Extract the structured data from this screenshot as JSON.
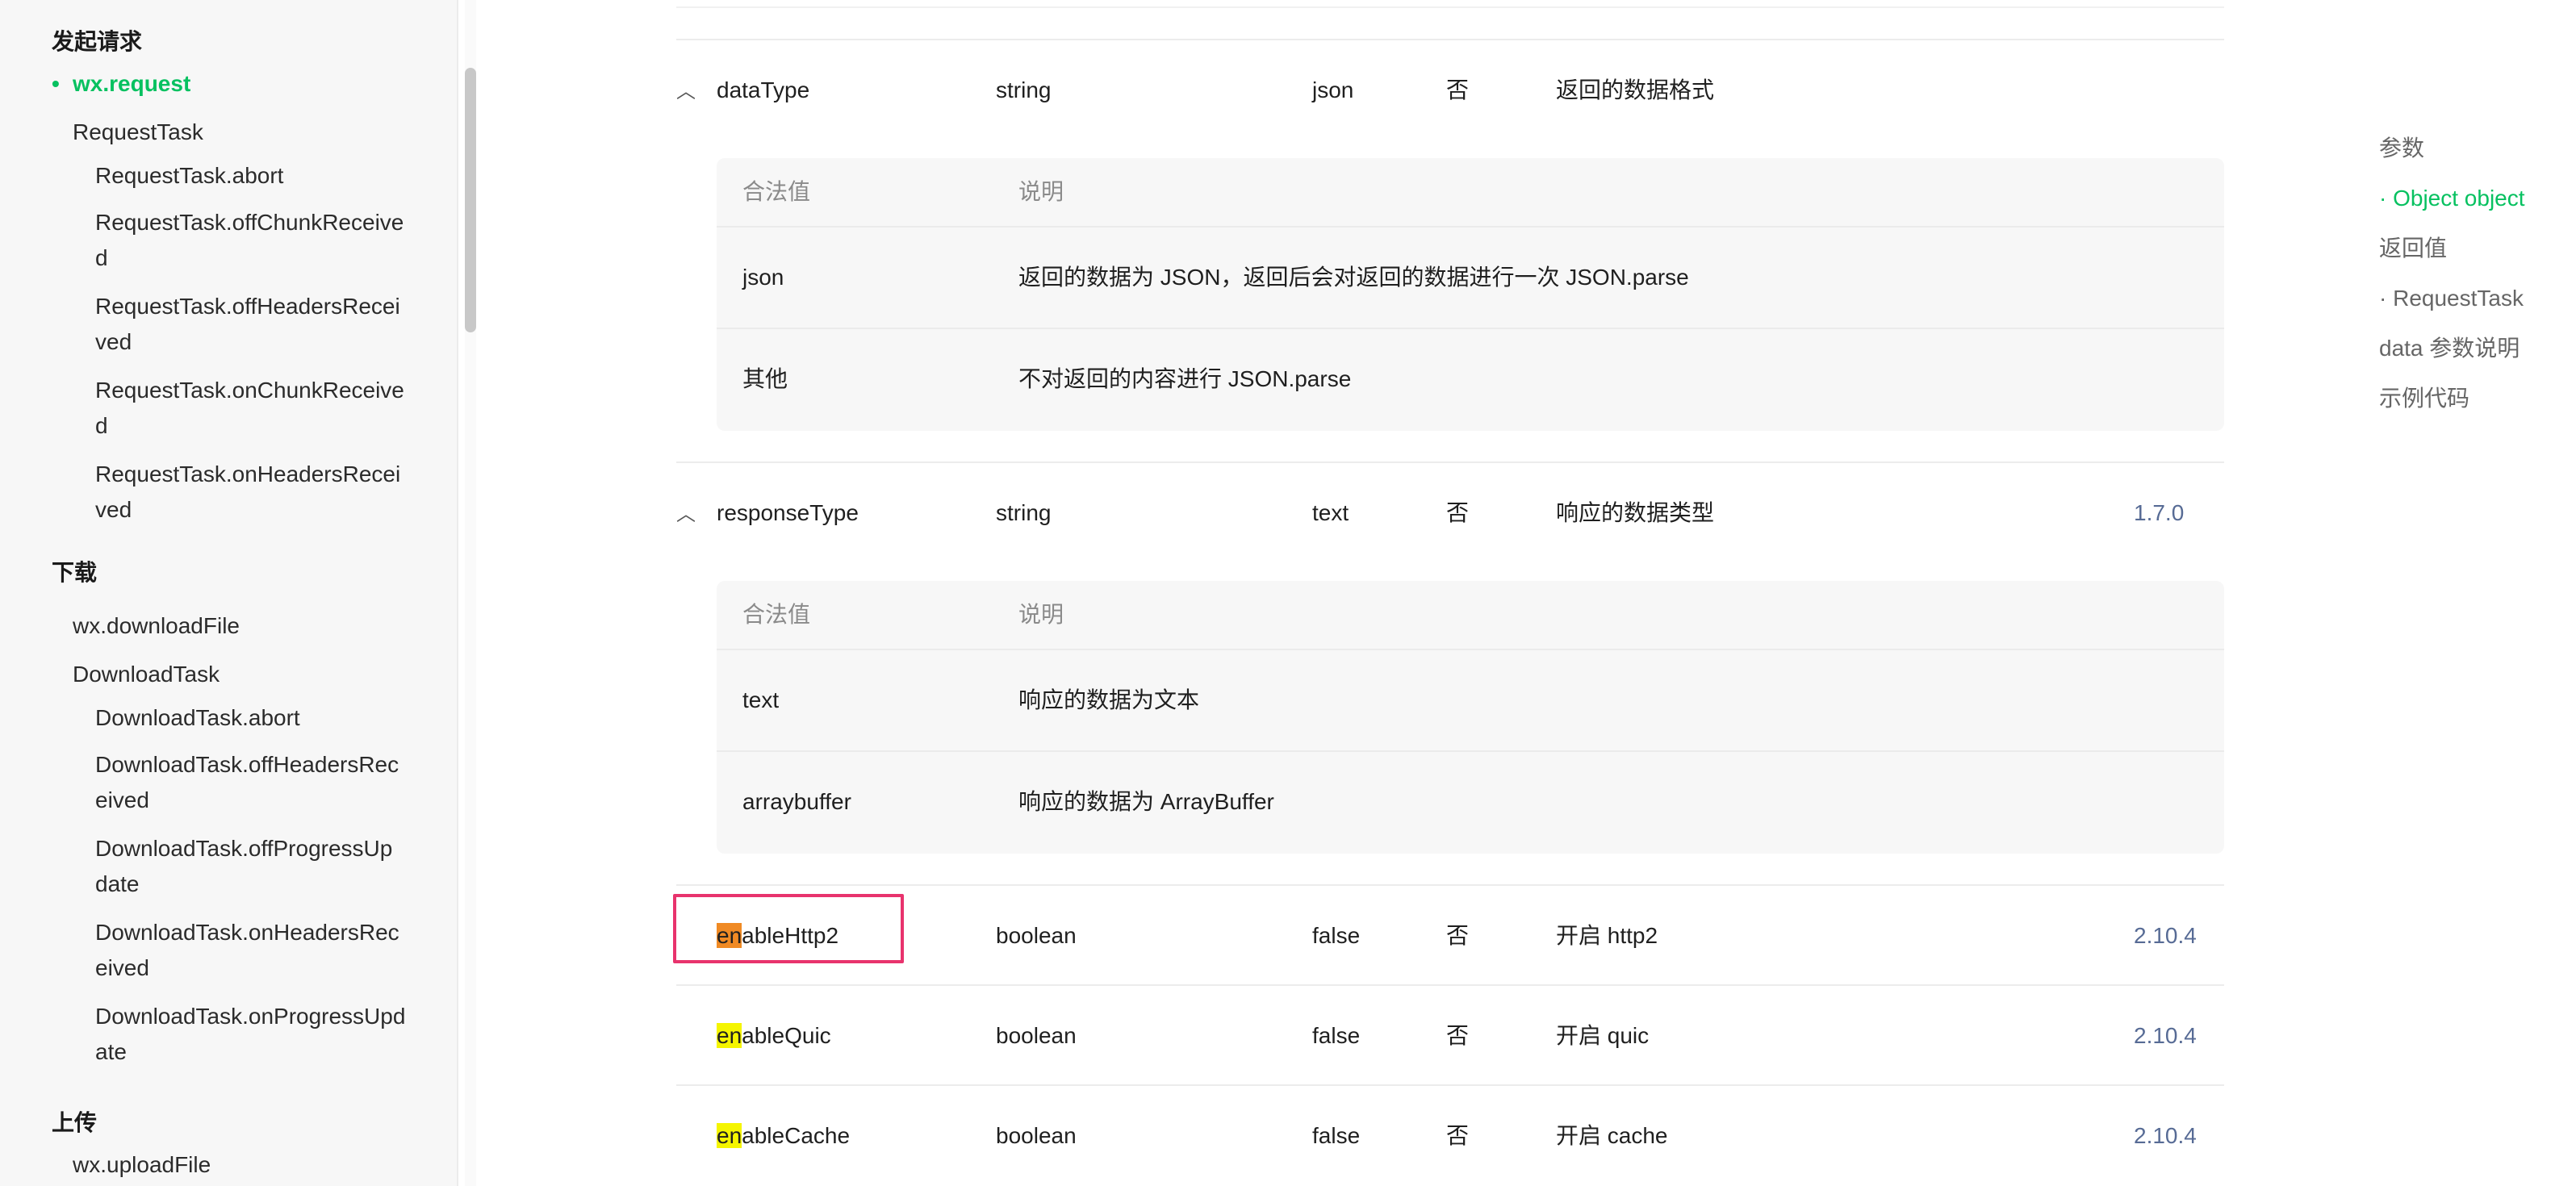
{
  "sidebar": {
    "section_request": "发起请求",
    "wx_request": "wx.request",
    "request_task": "RequestTask",
    "request_task_methods": [
      "RequestTask.abort",
      "RequestTask.offChunkReceive",
      "d",
      "RequestTask.offHeadersRecei",
      "ved",
      "RequestTask.onChunkReceive",
      "d",
      "RequestTask.onHeadersRecei",
      "ved"
    ],
    "section_download": "下载",
    "wx_download": "wx.downloadFile",
    "download_task": "DownloadTask",
    "download_task_methods": [
      "DownloadTask.abort",
      "DownloadTask.offHeadersRec",
      "eived",
      "DownloadTask.offProgressUp",
      "date",
      "DownloadTask.onHeadersRec",
      "eived",
      "DownloadTask.onProgressUpd",
      "ate"
    ],
    "section_upload": "上传",
    "wx_upload": "wx.uploadFile"
  },
  "params": {
    "dataType": {
      "name": "dataType",
      "type": "string",
      "default": "json",
      "required": "否",
      "desc": "返回的数据格式",
      "version": "",
      "sub_head": [
        "合法值",
        "说明"
      ],
      "sub_rows": [
        [
          "json",
          "返回的数据为 JSON，返回后会对返回的数据进行一次 JSON.parse"
        ],
        [
          "其他",
          "不对返回的内容进行 JSON.parse"
        ]
      ]
    },
    "responseType": {
      "name": "responseType",
      "type": "string",
      "default": "text",
      "required": "否",
      "desc": "响应的数据类型",
      "version": "1.7.0",
      "sub_head": [
        "合法值",
        "说明"
      ],
      "sub_rows": [
        [
          "text",
          "响应的数据为文本"
        ],
        [
          "arraybuffer",
          "响应的数据为 ArrayBuffer"
        ]
      ]
    },
    "enableHttp2": {
      "hl": "en",
      "rest": "ableHttp2",
      "type": "boolean",
      "default": "false",
      "required": "否",
      "desc": "开启 http2",
      "version": "2.10.4"
    },
    "enableQuic": {
      "hl": "en",
      "rest": "ableQuic",
      "type": "boolean",
      "default": "false",
      "required": "否",
      "desc": "开启 quic",
      "version": "2.10.4"
    },
    "enableCache": {
      "hl": "en",
      "rest": "ableCache",
      "type": "boolean",
      "default": "false",
      "required": "否",
      "desc": "开启 cache",
      "version": "2.10.4"
    }
  },
  "toc": {
    "items": [
      "参数",
      "· Object object",
      "返回值",
      "· RequestTask",
      "data 参数说明",
      "示例代码"
    ],
    "active_index": 1
  },
  "colors": {
    "accent": "#07c160",
    "version_link": "#576b95",
    "search_highlight": "#f5f500",
    "current_highlight": "#f08a24",
    "focus_box": "#e8336d"
  },
  "icons": {
    "expand": "chevron-up-icon"
  }
}
